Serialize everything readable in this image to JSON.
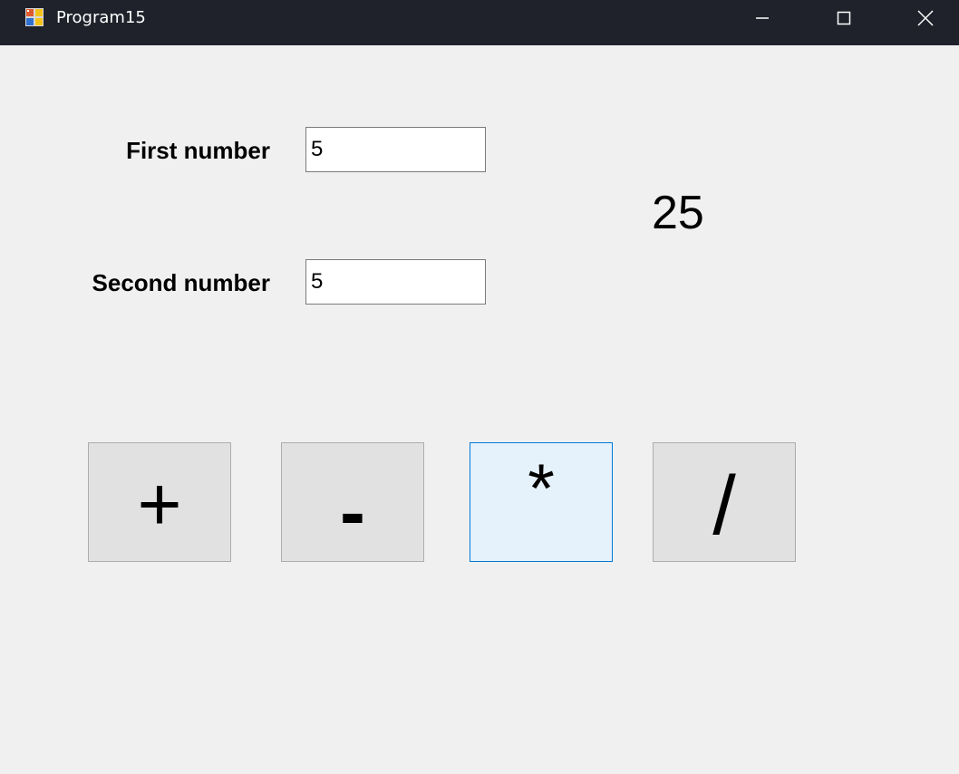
{
  "window": {
    "title": "Program15",
    "icon": "app-icon",
    "controls": {
      "minimize_icon": "minimize-icon",
      "maximize_icon": "maximize-icon",
      "close_icon": "close-icon"
    }
  },
  "form": {
    "first_label": "First number",
    "first_value": "5",
    "second_label": "Second number",
    "second_value": "5",
    "result": "25"
  },
  "operations": {
    "plus": "+",
    "minus": "-",
    "multiply": "*",
    "divide": "/"
  },
  "colors": {
    "titlebar": "#1f222a",
    "background": "#f0f0f0",
    "button_face": "#e1e1e1",
    "button_hover": "#e5f1fb",
    "button_hover_border": "#0078d7"
  }
}
